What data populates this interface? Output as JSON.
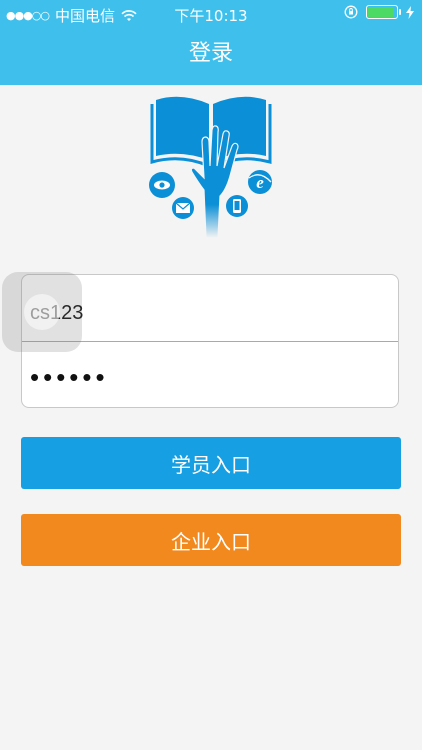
{
  "status_bar": {
    "signal": "●●●○○",
    "carrier": "中国电信",
    "time": "下午10:13"
  },
  "nav": {
    "title": "登录"
  },
  "login_form": {
    "username_value": "cs123",
    "password_value": "••••••"
  },
  "buttons": {
    "student_label": "学员入口",
    "company_label": "企业入口"
  },
  "colors": {
    "header": "#3fc0ec",
    "student_button": "#16a0e3",
    "company_button": "#f2891f",
    "logo_blue": "#0b8fd6",
    "background": "#f4f4f4"
  }
}
